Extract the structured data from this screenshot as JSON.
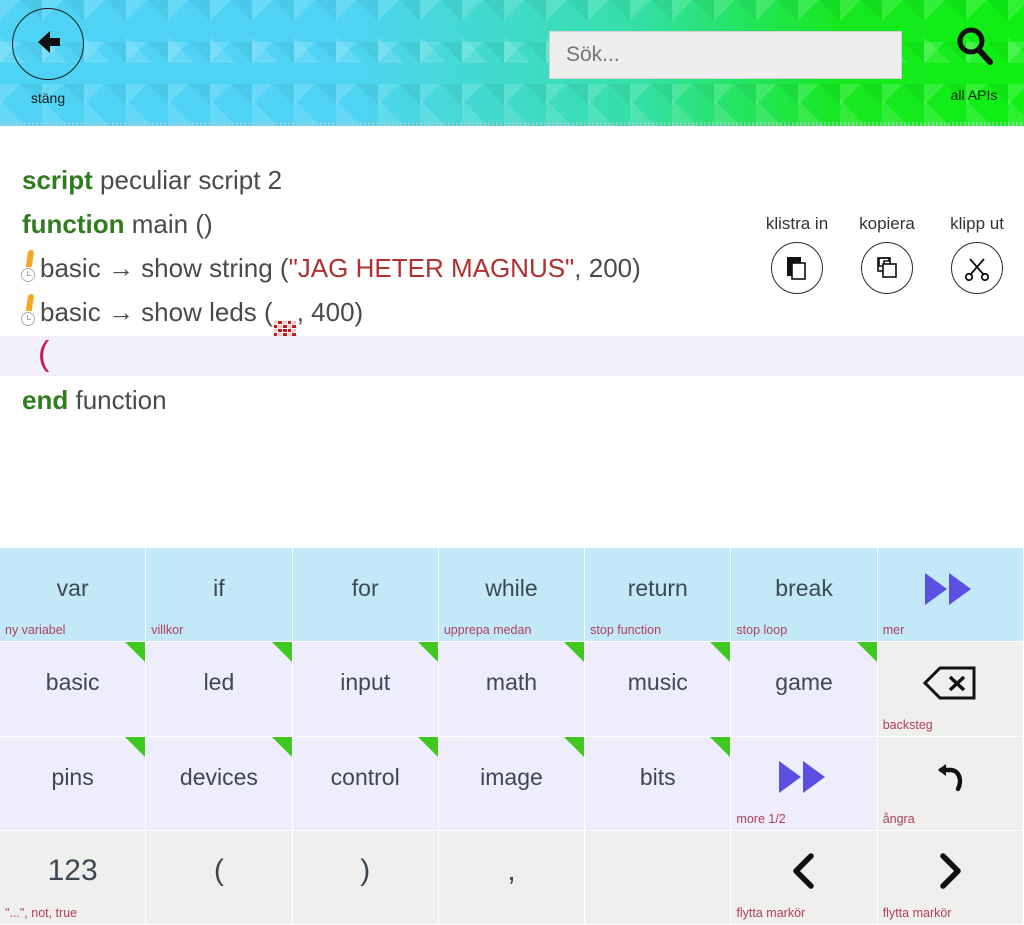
{
  "header": {
    "back_label": "stäng",
    "back_icon": "arrow-left-icon",
    "search_placeholder": "Sök...",
    "search_value": "",
    "api_label": "all APIs",
    "api_icon": "search-icon"
  },
  "code": {
    "script_keyword": "script",
    "script_name": "peculiar script 2",
    "function_keyword": "function",
    "function_name": "main ()",
    "end_keyword": "end",
    "end_word": "function",
    "lines": [
      {
        "receiver": "basic",
        "arrow": "→",
        "method": "show string",
        "open": "(",
        "string_arg": "\"JAG HETER MAGNUS\"",
        "comma": ", ",
        "num_arg": "200",
        "close": ")"
      },
      {
        "receiver": "basic",
        "arrow": "→",
        "method": "show leds",
        "open": "(",
        "image_arg": "led-matrix-image",
        "comma": ", ",
        "num_arg": "400",
        "close": ")"
      }
    ],
    "current_line_caret": "(",
    "led_pattern": [
      [
        0,
        1,
        0,
        1,
        0
      ],
      [
        1,
        0,
        1,
        0,
        1
      ],
      [
        0,
        1,
        1,
        1,
        0
      ],
      [
        1,
        0,
        1,
        0,
        1
      ],
      [
        0,
        1,
        1,
        1,
        0
      ]
    ]
  },
  "clipboard": {
    "actions": [
      {
        "label": "klistra in",
        "icon": "paste-icon"
      },
      {
        "label": "kopiera",
        "icon": "copy-icon"
      },
      {
        "label": "klipp ut",
        "icon": "scissors-icon"
      }
    ]
  },
  "keyboard": {
    "keys": [
      {
        "label": "var",
        "hint": "ny variabel",
        "style": "k-blue",
        "corner": false,
        "icon": null
      },
      {
        "label": "if",
        "hint": "villkor",
        "style": "k-blue",
        "corner": false,
        "icon": null
      },
      {
        "label": "for",
        "hint": "",
        "style": "k-blue",
        "corner": false,
        "icon": null
      },
      {
        "label": "while",
        "hint": "upprepa medan",
        "style": "k-blue",
        "corner": false,
        "icon": null
      },
      {
        "label": "return",
        "hint": "stop function",
        "style": "k-blue",
        "corner": false,
        "icon": null
      },
      {
        "label": "break",
        "hint": "stop loop",
        "style": "k-blue",
        "corner": false,
        "icon": null
      },
      {
        "label": "",
        "hint": "mer",
        "style": "k-blue",
        "corner": false,
        "icon": "fast-forward-icon"
      },
      {
        "label": "basic",
        "hint": "",
        "style": "k-lav",
        "corner": true,
        "icon": null
      },
      {
        "label": "led",
        "hint": "",
        "style": "k-lav",
        "corner": true,
        "icon": null
      },
      {
        "label": "input",
        "hint": "",
        "style": "k-lav",
        "corner": true,
        "icon": null
      },
      {
        "label": "math",
        "hint": "",
        "style": "k-lav",
        "corner": true,
        "icon": null
      },
      {
        "label": "music",
        "hint": "",
        "style": "k-lav",
        "corner": true,
        "icon": null
      },
      {
        "label": "game",
        "hint": "",
        "style": "k-lav",
        "corner": true,
        "icon": null
      },
      {
        "label": "",
        "hint": "backsteg",
        "style": "k-gray",
        "corner": false,
        "icon": "backspace-icon"
      },
      {
        "label": "pins",
        "hint": "",
        "style": "k-lav",
        "corner": true,
        "icon": null
      },
      {
        "label": "devices",
        "hint": "",
        "style": "k-lav",
        "corner": true,
        "icon": null
      },
      {
        "label": "control",
        "hint": "",
        "style": "k-lav",
        "corner": true,
        "icon": null
      },
      {
        "label": "image",
        "hint": "",
        "style": "k-lav",
        "corner": true,
        "icon": null
      },
      {
        "label": "bits",
        "hint": "",
        "style": "k-lav",
        "corner": true,
        "icon": null
      },
      {
        "label": "",
        "hint": "more 1/2",
        "style": "k-lav",
        "corner": false,
        "icon": "fast-forward-icon"
      },
      {
        "label": "",
        "hint": "ångra",
        "style": "k-gray",
        "corner": false,
        "icon": "undo-icon"
      },
      {
        "label": "123",
        "hint": "\"...\", not, true",
        "style": "k-gray",
        "corner": false,
        "icon": null,
        "big": true
      },
      {
        "label": "(",
        "hint": "",
        "style": "k-gray",
        "corner": false,
        "icon": null,
        "big": true
      },
      {
        "label": ")",
        "hint": "",
        "style": "k-gray",
        "corner": false,
        "icon": null,
        "big": true
      },
      {
        "label": ",",
        "hint": "",
        "style": "k-gray",
        "corner": false,
        "icon": null,
        "big": true
      },
      {
        "label": "",
        "hint": "",
        "style": "k-gray",
        "corner": false,
        "icon": null
      },
      {
        "label": "",
        "hint": "flytta markör",
        "style": "k-gray",
        "corner": false,
        "icon": "chevron-left-icon"
      },
      {
        "label": "",
        "hint": "flytta markör",
        "style": "k-gray",
        "corner": false,
        "icon": "chevron-right-icon"
      }
    ]
  },
  "colors": {
    "keyword_green": "#2f7d1f",
    "string_red": "#b03030",
    "hint_red": "#b0405a",
    "accent_blue": "#c3e8f8",
    "accent_lavender": "#eeedfb",
    "corner_green": "#3ec820",
    "ff_purple": "#5a4fe0",
    "caret_crimson": "#c02050"
  }
}
